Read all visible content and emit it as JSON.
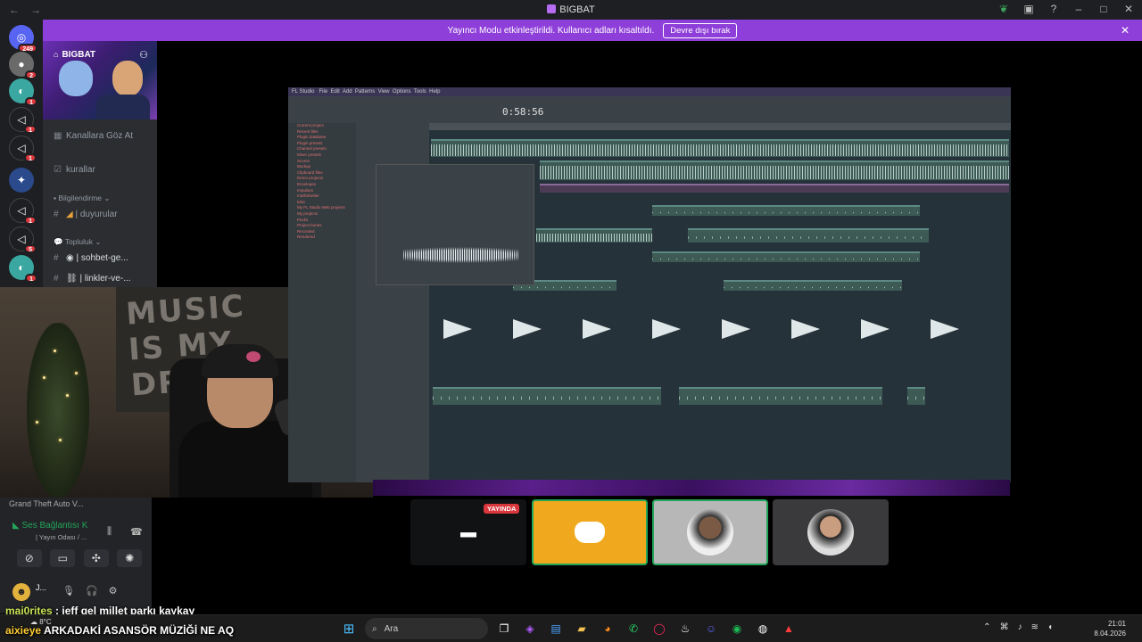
{
  "window": {
    "title": "BIGBAT",
    "back_icon": "←",
    "forward_icon": "→"
  },
  "banner": {
    "message": "Yayıncı Modu etkinleştirildi. Kullanıcı adları kısaltıldı.",
    "button": "Devre dışı bırak"
  },
  "rail": {
    "dm_badge": "249",
    "badges": [
      "2",
      "1",
      "1",
      "1",
      "1",
      "5",
      "1"
    ]
  },
  "sidebar": {
    "server_name": "BIGBAT",
    "browse_channels": "Kanallara Göz At",
    "rules": "kurallar",
    "category_info": "Bilgilendirme",
    "announcements": "| duyurular",
    "category_community": "Topluluk",
    "chat": "| sohbet-ge...",
    "links": "| linkler-ve-..."
  },
  "voice_panel": {
    "prev_text": "Grand Theft Auto V...",
    "status": "Ses Bağlantısı K",
    "channel": "| Yayın Odası / ...",
    "user_name": "J...",
    "colors": {
      "connected": "#23a55a"
    }
  },
  "daw": {
    "time": "0:58:56",
    "menu": [
      "FL Studio",
      "File",
      "Edit",
      "Add",
      "Patterns",
      "View",
      "Options",
      "Tools",
      "Help"
    ],
    "browser_items": [
      "Current project",
      "Recent files",
      "Plugin database",
      "Plugin presets",
      "Channel presets",
      "Mixer presets",
      "Scores",
      "Backup",
      "Clipboard files",
      "Demo projects",
      "Envelopes",
      "Impulses",
      "IntelliShelter",
      "Misc",
      "My FL Studio Web projects",
      "My projects",
      "Packs",
      "Project bones",
      "Recorded",
      "Rendered"
    ]
  },
  "stage": {
    "live_label": "YAYINDA"
  },
  "chat": [
    {
      "user": "maj0rites",
      "message": ": jeff gel millet parkı kaykay"
    },
    {
      "user": "aixieye",
      "message": "ARKADAKİ ASANSÖR MÜZİĞİ NE AQ"
    }
  ],
  "taskbar": {
    "weather": "8°C",
    "search_placeholder": "Ara",
    "time": "21:01",
    "date": "8.04.2026"
  }
}
